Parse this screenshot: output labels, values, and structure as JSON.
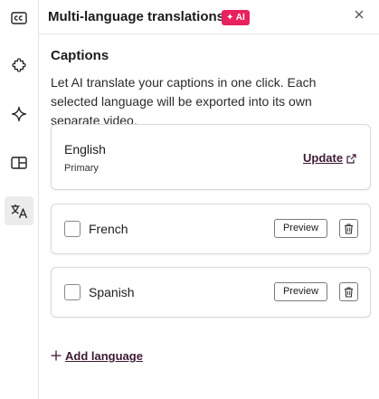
{
  "rail": {
    "items": [
      {
        "icon": "captions-icon",
        "active": false
      },
      {
        "icon": "puzzle-icon",
        "active": false
      },
      {
        "icon": "sparkle-icon",
        "active": false
      },
      {
        "icon": "layout-icon",
        "active": false
      },
      {
        "icon": "translate-icon",
        "active": true
      }
    ]
  },
  "header": {
    "title": "Multi-language translations",
    "badge": "✦ AI",
    "close_icon": "close-icon"
  },
  "captions": {
    "heading": "Captions",
    "description": "Let AI translate your captions in one click. Each selected language will be exported into its own separate video."
  },
  "primary_language": {
    "name": "English",
    "role": "Primary",
    "update_label": "Update",
    "update_icon": "external-link-icon"
  },
  "languages": [
    {
      "name": "French",
      "checked": false,
      "preview_label": "Preview",
      "delete_icon": "trash-icon"
    },
    {
      "name": "Spanish",
      "checked": false,
      "preview_label": "Preview",
      "delete_icon": "trash-icon"
    }
  ],
  "add_language": {
    "label": "Add language",
    "icon": "plus-icon"
  },
  "colors": {
    "accent_badge": "#e8225f",
    "link": "#3d1a33",
    "border": "#d9d9d9",
    "active_rail": "#ececec"
  }
}
